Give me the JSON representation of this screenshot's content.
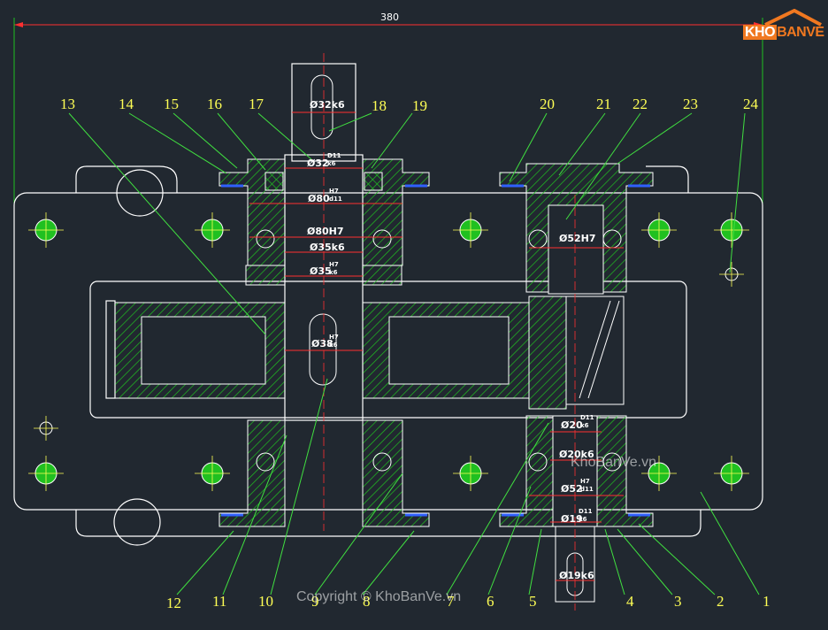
{
  "logo": {
    "brand_left": "KHO",
    "brand_right": "BANVE"
  },
  "overall_dimension": "380",
  "dimensions": {
    "shaft_top_key": "Ø32k6",
    "bearing_d11": "D11",
    "bearing_k6": "k6",
    "d32_shoulder": "Ø32",
    "d80": "Ø80",
    "h7": "H7",
    "d11": "d11",
    "d80h7": "Ø80H7",
    "d35k6": "Ø35k6",
    "d35": "Ø35",
    "d38": "Ø38",
    "d52h7": "Ø52H7",
    "d20_top": "Ø20",
    "d20k6": "Ø20k6",
    "d52_bottom": "Ø52",
    "d19": "Ø19",
    "d19k6": "Ø19k6"
  },
  "part_numbers_top": [
    "13",
    "14",
    "15",
    "16",
    "17",
    "18",
    "19",
    "20",
    "21",
    "22",
    "23",
    "24"
  ],
  "part_numbers_bottom": [
    "12",
    "11",
    "10",
    "9",
    "8",
    "7",
    "6",
    "5",
    "4",
    "3",
    "2",
    "1"
  ],
  "watermarks": {
    "right": "KhoBanVe.vn",
    "bottom": "Copyright © KhoBanVe.vn"
  },
  "colors": {
    "background": "#212830",
    "outline": "#ffffff",
    "hatch": "#20c020",
    "leader": "#40e040",
    "center": "#ff3030",
    "label": "#ffff55",
    "seal": "#3060ff",
    "logo_orange": "#f07820"
  }
}
